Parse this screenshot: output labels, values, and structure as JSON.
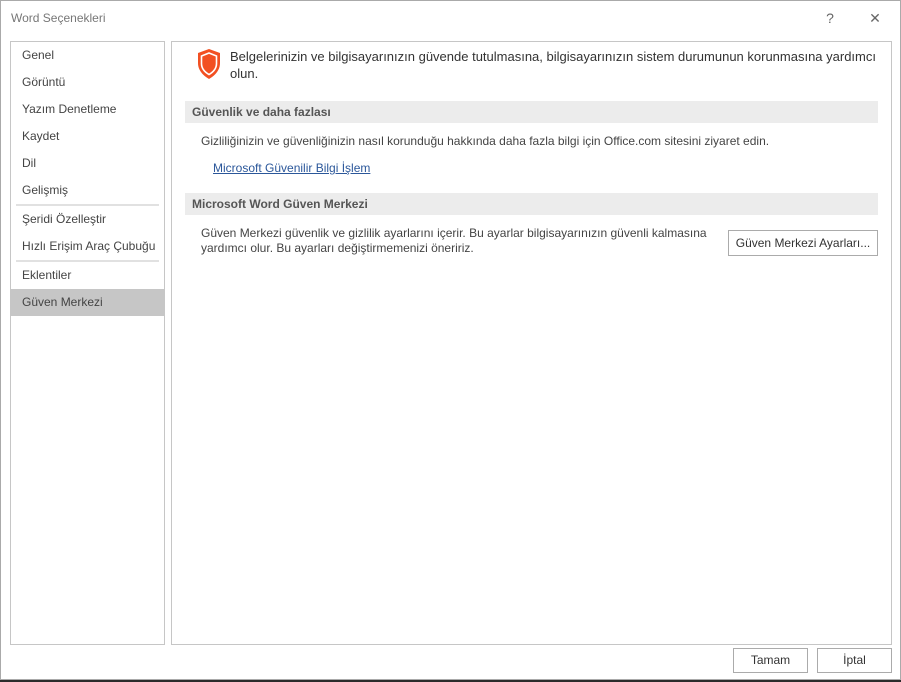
{
  "window": {
    "title": "Word Seçenekleri",
    "help": "?",
    "close": "✕"
  },
  "sidebar": {
    "items": [
      {
        "label": "Genel"
      },
      {
        "label": "Görüntü"
      },
      {
        "label": "Yazım Denetleme"
      },
      {
        "label": "Kaydet"
      },
      {
        "label": "Dil"
      },
      {
        "label": "Gelişmiş"
      },
      {
        "label": "Şeridi Özelleştir"
      },
      {
        "label": "Hızlı Erişim Araç Çubuğu"
      },
      {
        "label": "Eklentiler"
      },
      {
        "label": "Güven Merkezi"
      }
    ],
    "selected": "Güven Merkezi"
  },
  "main": {
    "intro": "Belgelerinizin ve bilgisayarınızın güvende tutulmasına, bilgisayarınızın sistem durumunun korunmasına yardımcı olun.",
    "security": {
      "header": "Güvenlik ve daha fazlası",
      "text": "Gizliliğinizin ve güvenliğinizin nasıl korunduğu hakkında daha fazla bilgi için Office.com sitesini ziyaret edin.",
      "link": "Microsoft Güvenilir Bilgi İşlem"
    },
    "trust": {
      "header": "Microsoft Word Güven Merkezi",
      "text1": "Güven Merkezi güvenlik ve gizlilik ayarlarını içerir. Bu ayarlar bilgisayarınızın güvenli kalmasına",
      "text2": "yardımcı olur. Bu ayarları değiştirmemenizi öneririz.",
      "button": "Güven Merkezi Ayarları..."
    }
  },
  "footer": {
    "ok": "Tamam",
    "cancel": "İptal"
  },
  "colors": {
    "shield": "#f25022",
    "selected": "#c6c6c6",
    "link": "#2b579a"
  }
}
